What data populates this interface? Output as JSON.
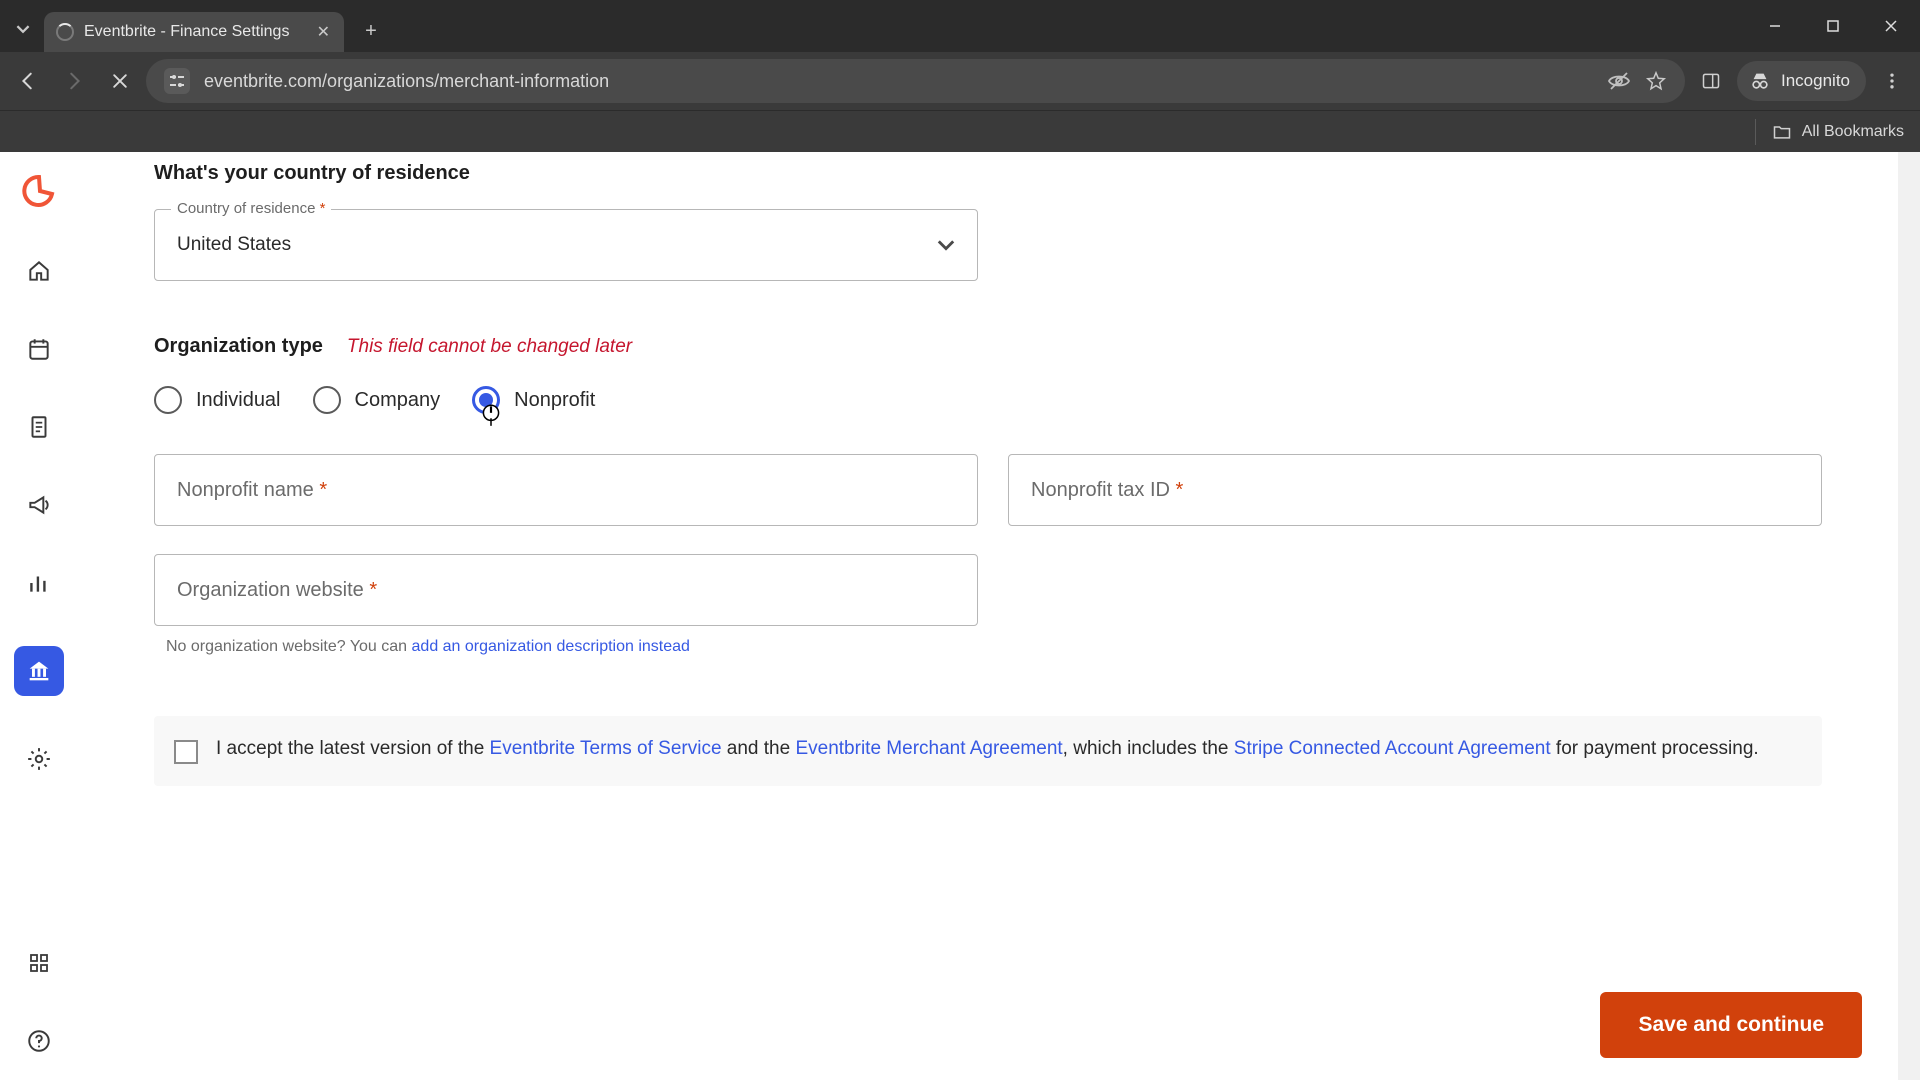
{
  "browser": {
    "tab_title": "Eventbrite - Finance Settings",
    "url": "eventbrite.com/organizations/merchant-information",
    "incognito_label": "Incognito",
    "bookmarks_label": "All Bookmarks"
  },
  "form": {
    "country_heading": "What's your country of residence",
    "country_label": "Country of residence",
    "country_value": "United States",
    "org_type_heading": "Organization type",
    "org_type_warning": "This field cannot be changed later",
    "org_type_options": {
      "individual": "Individual",
      "company": "Company",
      "nonprofit": "Nonprofit"
    },
    "nonprofit_name_label": "Nonprofit name",
    "nonprofit_tax_id_label": "Nonprofit tax ID",
    "org_website_label": "Organization website",
    "website_helper_prefix": "No organization website? You can ",
    "website_helper_link": "add an organization description instead",
    "accept_prefix": "I accept the latest version of the ",
    "tos_link": "Eventbrite Terms of Service",
    "accept_mid1": " and the ",
    "merchant_link": "Eventbrite Merchant Agreement",
    "accept_mid2": ", which includes the ",
    "stripe_link": "Stripe Connected Account Agreement",
    "accept_suffix": " for payment processing.",
    "save_button": "Save and continue"
  },
  "required_marker": "*"
}
